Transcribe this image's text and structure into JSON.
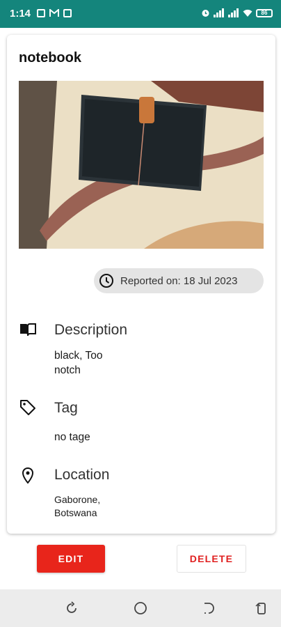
{
  "status_bar": {
    "time": "1:14",
    "battery": "86",
    "left_icons": [
      "notification-icon",
      "gmail-icon",
      "calendar-icon"
    ],
    "right_icons": [
      "alarm-icon",
      "signal-icon",
      "signal-icon",
      "wifi-icon",
      "battery-icon"
    ]
  },
  "item": {
    "title": "notebook",
    "reported": "Reported on: 18 Jul 2023",
    "description_heading": "Description",
    "description": "black, Too notch",
    "tag_heading": "Tag",
    "tag": "no tage",
    "location_heading": "Location",
    "location": "Gaborone, Botswana"
  },
  "actions": {
    "edit_label": "EDIT",
    "delete_label": "DELETE"
  },
  "nav_bar": {
    "buttons": [
      "recents-icon",
      "home-icon",
      "back-icon",
      "rotate-icon"
    ]
  },
  "colors": {
    "status_bar": "#14857c",
    "edit_button": "#e8251b",
    "delete_text": "#e02020",
    "chip_bg": "#e4e4e4"
  }
}
